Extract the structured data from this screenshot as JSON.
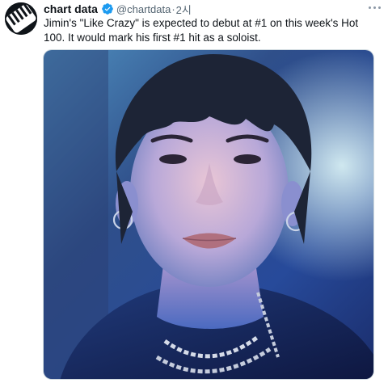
{
  "tweet": {
    "display_name": "chart data",
    "handle": "@chartdata",
    "separator": "·",
    "time": "2시",
    "text": "Jimin's \"Like Crazy\" is expected to debut at #1 on this week's Hot 100. It would mark his first #1 hit as a soloist.",
    "verified": true
  },
  "icons": {
    "avatar": "chart-data-logo-avatar",
    "verified": "verified-badge-icon",
    "more": "more-options-icon"
  },
  "colors": {
    "text": "#0f1419",
    "secondary": "#536471",
    "verified": "#1d9bf0"
  }
}
